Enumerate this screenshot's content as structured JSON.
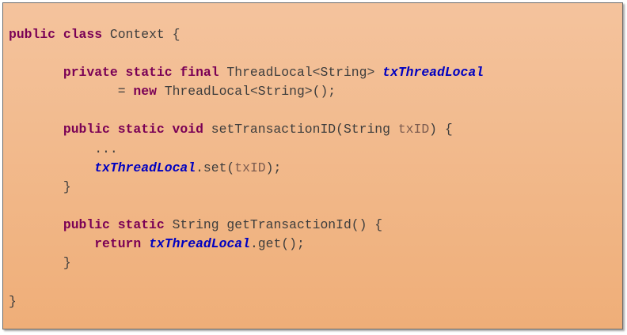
{
  "code": {
    "lines": [
      [
        {
          "t": "public class",
          "c": "kw"
        },
        {
          "t": " Context {",
          "c": "txt"
        }
      ],
      [
        {
          "t": "       private static final",
          "c": "kw"
        },
        {
          "t": " ThreadLocal<String> ",
          "c": "txt"
        },
        {
          "t": "txThreadLocal",
          "c": "field"
        }
      ],
      [
        {
          "t": "              = ",
          "c": "txt"
        },
        {
          "t": "new",
          "c": "kw"
        },
        {
          "t": " ThreadLocal<String>();",
          "c": "txt"
        }
      ],
      [
        {
          "t": "       public static void",
          "c": "kw"
        },
        {
          "t": " setTransactionID(String ",
          "c": "txt"
        },
        {
          "t": "txID",
          "c": "param"
        },
        {
          "t": ") {",
          "c": "txt"
        }
      ],
      [
        {
          "t": "           ...",
          "c": "txt"
        }
      ],
      [
        {
          "t": "           ",
          "c": "txt"
        },
        {
          "t": "txThreadLocal",
          "c": "field"
        },
        {
          "t": ".set(",
          "c": "txt"
        },
        {
          "t": "txID",
          "c": "param"
        },
        {
          "t": ");",
          "c": "txt"
        }
      ],
      [
        {
          "t": "       }",
          "c": "txt"
        }
      ],
      [
        {
          "t": "       public static",
          "c": "kw"
        },
        {
          "t": " String getTransactionId() {",
          "c": "txt"
        }
      ],
      [
        {
          "t": "           ",
          "c": "txt"
        },
        {
          "t": "return",
          "c": "kw"
        },
        {
          "t": " ",
          "c": "txt"
        },
        {
          "t": "txThreadLocal",
          "c": "field"
        },
        {
          "t": ".get();",
          "c": "txt"
        }
      ],
      [
        {
          "t": "       }",
          "c": "txt"
        }
      ],
      [
        {
          "t": "}",
          "c": "txt"
        }
      ]
    ]
  }
}
